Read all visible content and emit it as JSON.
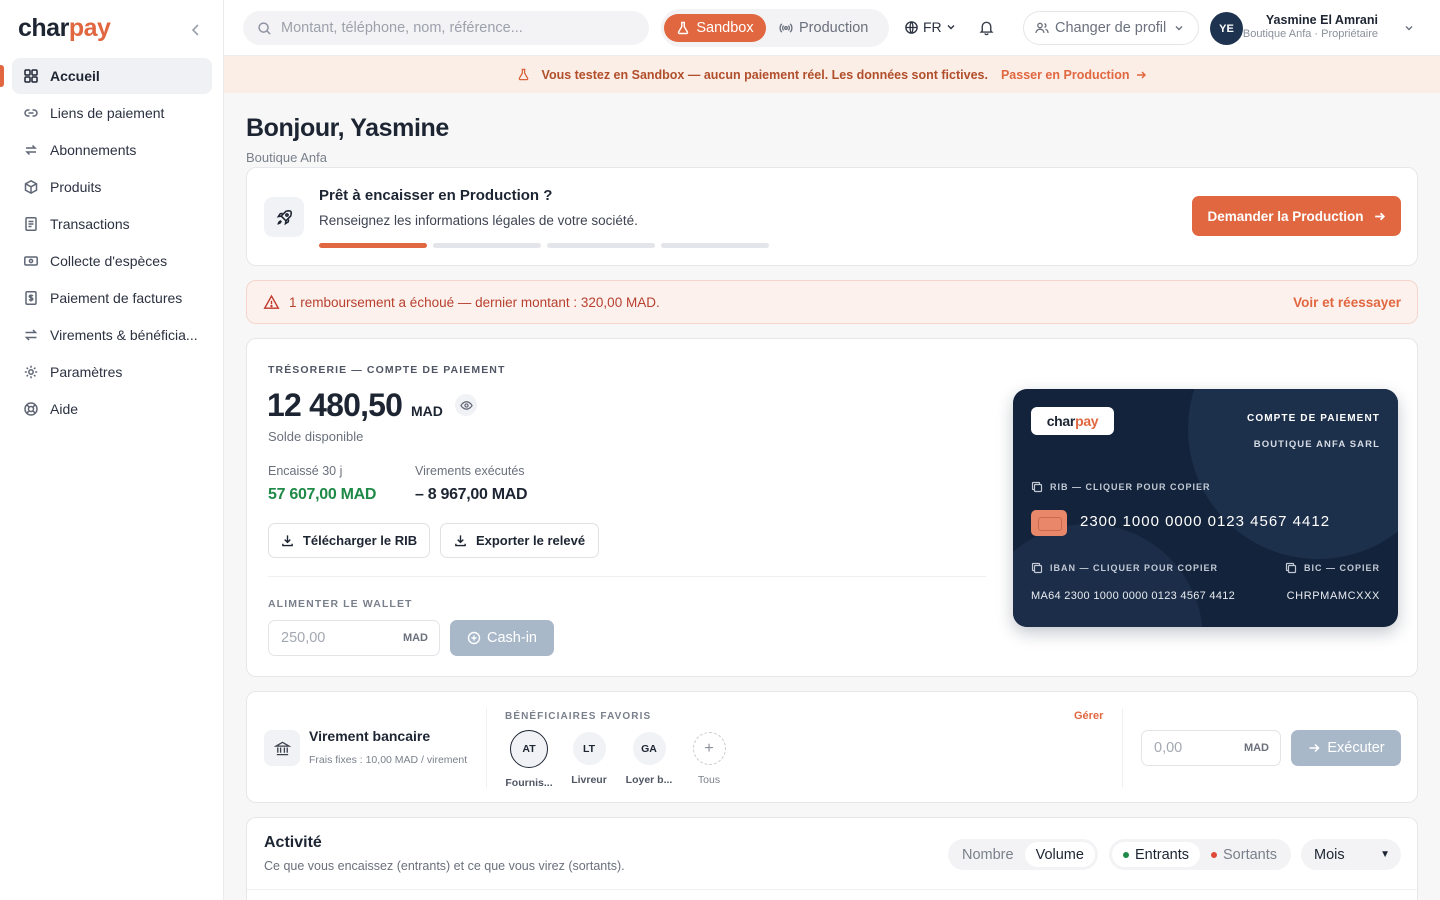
{
  "brand": {
    "logo_main": "char",
    "logo_accent": "pay"
  },
  "sidebar": {
    "items": [
      {
        "label": "Accueil",
        "icon": "grid-icon",
        "active": true
      },
      {
        "label": "Liens de paiement",
        "icon": "link-icon"
      },
      {
        "label": "Abonnements",
        "icon": "repeat-icon"
      },
      {
        "label": "Produits",
        "icon": "box-icon"
      },
      {
        "label": "Transactions",
        "icon": "receipt-icon"
      },
      {
        "label": "Collecte d'espèces",
        "icon": "banknote-icon"
      },
      {
        "label": "Paiement de factures",
        "icon": "invoice-icon"
      },
      {
        "label": "Virements & bénéficia...",
        "icon": "transfer-icon"
      },
      {
        "label": "Paramètres",
        "icon": "gear-icon"
      },
      {
        "label": "Aide",
        "icon": "lifebuoy-icon"
      }
    ]
  },
  "topbar": {
    "search_placeholder": "Montant, téléphone, nom, référence...",
    "env": {
      "sandbox": "Sandbox",
      "production": "Production",
      "selected": "Sandbox"
    },
    "lang": "FR",
    "profile_switch": "Changer de profil",
    "user": {
      "initials": "YE",
      "name": "Yasmine El Amrani",
      "role": "Boutique Anfa · Propriétaire"
    }
  },
  "banner": {
    "text": "Vous testez en Sandbox — aucun paiement réel. Les données sont fictives.",
    "link": "Passer en Production"
  },
  "greeting": {
    "title": "Bonjour, Yasmine",
    "subtitle": "Boutique Anfa"
  },
  "production_card": {
    "title": "Prêt à encaisser en Production ?",
    "subtitle": "Renseignez les informations légales de votre société.",
    "steps_total": 4,
    "steps_done": 1,
    "button": "Demander la Production"
  },
  "alert": {
    "text": "1 remboursement a échoué — dernier montant : 320,00 MAD.",
    "link": "Voir et réessayer"
  },
  "treasury": {
    "label": "TRÉSORERIE — COMPTE DE PAIEMENT",
    "balance": "12 480,50",
    "currency": "MAD",
    "balance_caption": "Solde disponible",
    "collected_label": "Encaissé 30 j",
    "collected_value": "57 607,00 MAD",
    "transfers_label": "Virements exécutés",
    "transfers_value": "– 8 967,00 MAD",
    "download_rib": "Télécharger le RIB",
    "export_statement": "Exporter le relevé",
    "wallet_label": "ALIMENTER LE WALLET",
    "wallet_placeholder": "250,00",
    "wallet_currency": "MAD",
    "cashin_button": "Cash-in"
  },
  "bank_card": {
    "logo_main": "char",
    "logo_accent": "pay",
    "account_type": "COMPTE DE PAIEMENT",
    "holder": "BOUTIQUE ANFA SARL",
    "rib_label": "RIB — CLIQUER POUR COPIER",
    "rib": "2300 1000 0000 0123 4567 4412",
    "iban_label": "IBAN — CLIQUER POUR COPIER",
    "iban": "MA64 2300 1000 0000 0123 4567 4412",
    "bic_label": "BIC — COPIER",
    "bic": "CHRPMAMCXXX"
  },
  "transfer": {
    "title": "Virement bancaire",
    "subtitle": "Frais fixes : 10,00 MAD / virement",
    "favorites_label": "BÉNÉFICIAIRES FAVORIS",
    "manage": "Gérer",
    "favorites": [
      {
        "initials": "AT",
        "name": "Fournis..."
      },
      {
        "initials": "LT",
        "name": "Livreur"
      },
      {
        "initials": "GA",
        "name": "Loyer b..."
      }
    ],
    "all_label": "Tous",
    "amount_placeholder": "0,00",
    "currency": "MAD",
    "execute_button": "Exécuter"
  },
  "activity": {
    "title": "Activité",
    "subtitle": "Ce que vous encaissez (entrants) et ce que vous virez (sortants).",
    "metric_options": [
      "Nombre",
      "Volume"
    ],
    "metric_selected": "Volume",
    "flow_options": [
      "Entrants",
      "Sortants"
    ],
    "flow_selected": "Entrants",
    "period": "Mois",
    "colors": {
      "in": "#1f8a47",
      "out": "#e0483a"
    }
  }
}
